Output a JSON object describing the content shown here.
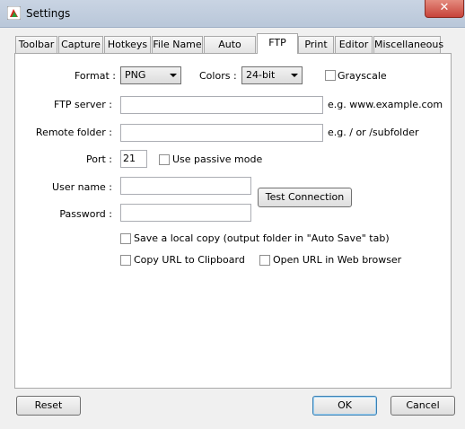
{
  "window": {
    "title": "Settings",
    "close_label": "✕"
  },
  "tabs": [
    {
      "label": "Toolbar"
    },
    {
      "label": "Capture"
    },
    {
      "label": "Hotkeys"
    },
    {
      "label": "File Name"
    },
    {
      "label": "Auto Save"
    },
    {
      "label": "FTP",
      "active": true
    },
    {
      "label": "Print"
    },
    {
      "label": "Editor"
    },
    {
      "label": "Miscellaneous"
    }
  ],
  "ftp": {
    "format_label": "Format :",
    "format_value": "PNG",
    "colors_label": "Colors :",
    "colors_value": "24-bit",
    "grayscale_label": "Grayscale",
    "server_label": "FTP server :",
    "server_value": "",
    "server_hint": "e.g. www.example.com",
    "remote_label": "Remote folder :",
    "remote_value": "",
    "remote_hint": "e.g. / or /subfolder",
    "port_label": "Port :",
    "port_value": "21",
    "passive_label": "Use passive mode",
    "username_label": "User name :",
    "username_value": "",
    "password_label": "Password :",
    "password_value": "",
    "test_button": "Test Connection",
    "save_local_label": "Save a local copy (output folder in \"Auto Save\" tab)",
    "copy_url_label": "Copy URL to Clipboard",
    "open_url_label": "Open URL in Web browser"
  },
  "footer": {
    "reset": "Reset",
    "ok": "OK",
    "cancel": "Cancel"
  }
}
